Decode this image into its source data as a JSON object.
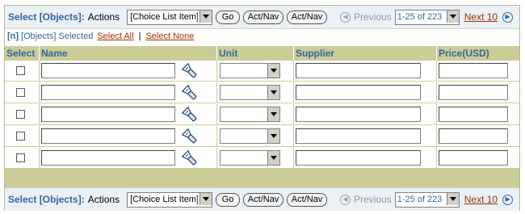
{
  "control_bar": {
    "select_label": "Select [Objects]:",
    "actions_label": "Actions",
    "choice_value": "[Choice List Item]",
    "go_label": "Go",
    "act_nav_1": "Act/Nav",
    "act_nav_2": "Act/Nav",
    "previous_label": "Previous",
    "range_value": "1-25 of 223",
    "next_label": "Next 10"
  },
  "selection": {
    "count": "[n]",
    "objects_selected": "[Objects] Selected",
    "select_all": "Select All",
    "separator": "|",
    "select_none": "Select None"
  },
  "table": {
    "columns": [
      "Select",
      "Name",
      "Unit",
      "Supplier",
      "Price(USD)"
    ],
    "rows": [
      {
        "name": "",
        "unit": "",
        "supplier": "",
        "price": ""
      },
      {
        "name": "",
        "unit": "",
        "supplier": "",
        "price": ""
      },
      {
        "name": "",
        "unit": "",
        "supplier": "",
        "price": ""
      },
      {
        "name": "",
        "unit": "",
        "supplier": "",
        "price": ""
      },
      {
        "name": "",
        "unit": "",
        "supplier": "",
        "price": ""
      }
    ]
  },
  "icons": {
    "lookup": "flashlight-icon",
    "previous": "previous-arrow-icon",
    "next": "next-arrow-icon",
    "dropdown": "dropdown-arrow-icon"
  }
}
